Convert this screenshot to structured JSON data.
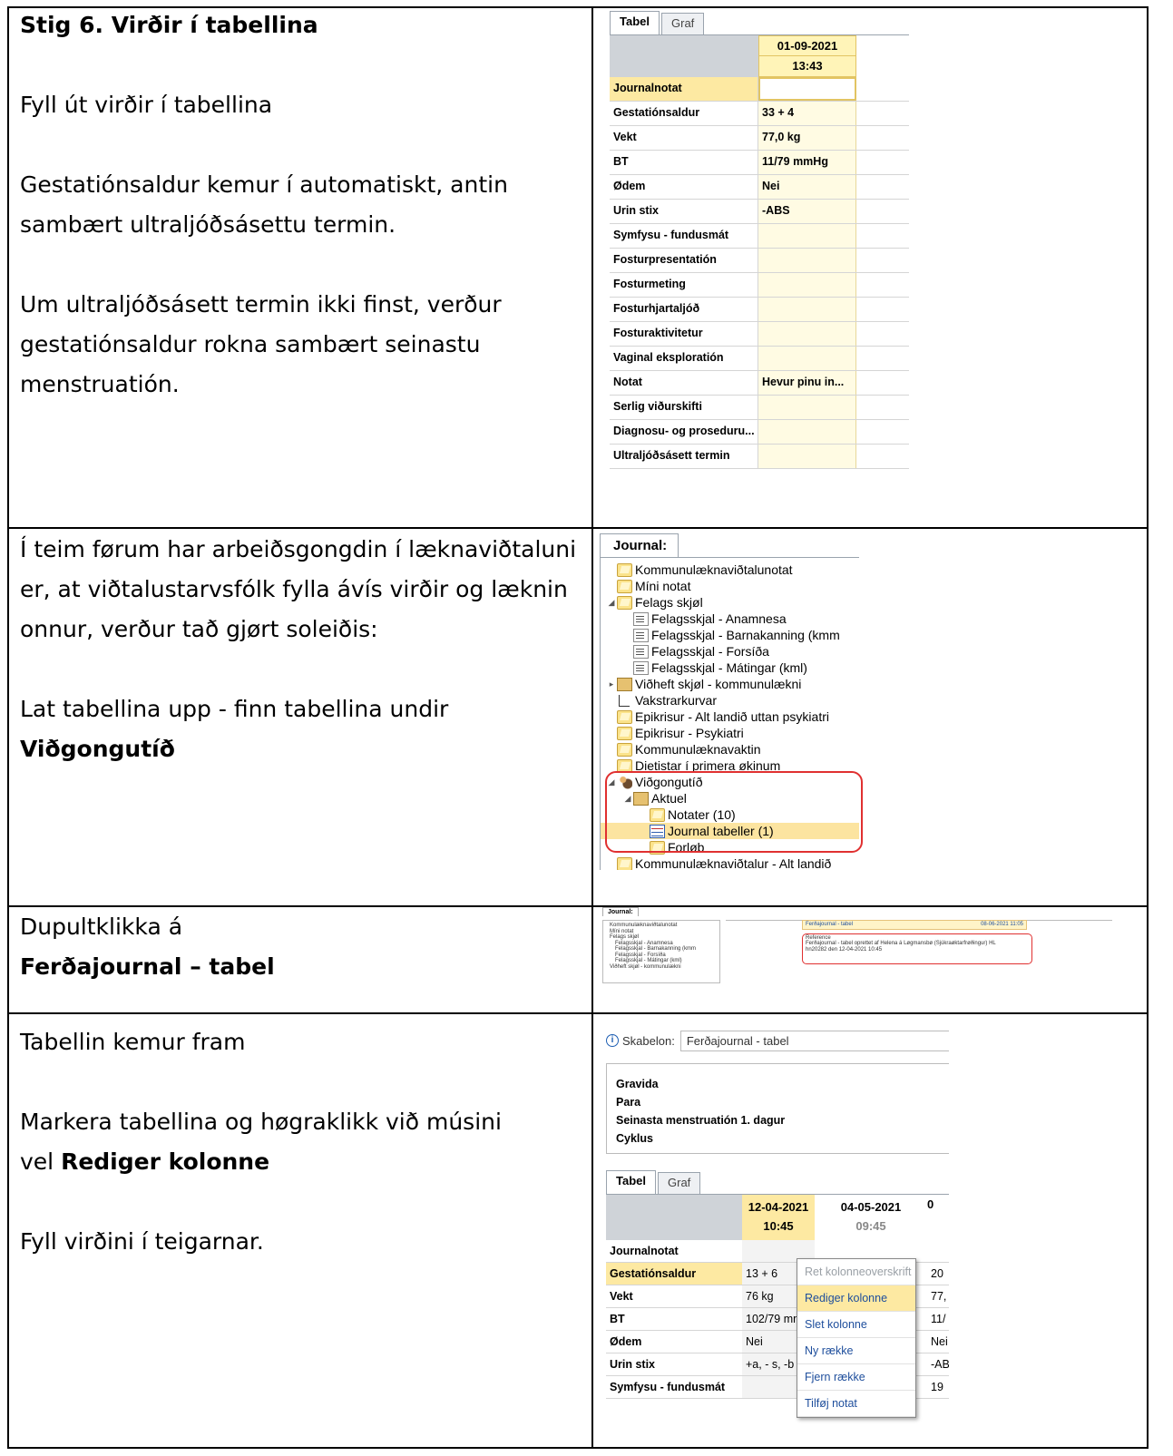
{
  "row1": {
    "title": "Stig 6. Virðir í tabellina",
    "p1": "Fyll út virðir í tabellina",
    "p2a": "Gestatiónsaldur kemur í automatiskt, antin",
    "p2b": "sambært ultraljóðsásettu termin.",
    "p3a": "Um ultraljóðsásett termin ikki finst, verður",
    "p3b": "gestatiónsaldur rokna sambært seinastu",
    "p3c": "menstruatión.",
    "ui": {
      "tabs": [
        "Tabel",
        "Graf"
      ],
      "date": "01-09-2021",
      "time": "13:43",
      "rows": [
        {
          "label": "Journalnotat",
          "value": ""
        },
        {
          "label": "Gestatiónsaldur",
          "value": "33 + 4"
        },
        {
          "label": "Vekt",
          "value": "77,0 kg"
        },
        {
          "label": "BT",
          "value": "11/79 mmHg"
        },
        {
          "label": "Ødem",
          "value": "Nei"
        },
        {
          "label": "Urin stix",
          "value": "-ABS"
        },
        {
          "label": "Symfysu - fundusmát",
          "value": ""
        },
        {
          "label": "Fosturpresentatión",
          "value": ""
        },
        {
          "label": "Fosturmeting",
          "value": ""
        },
        {
          "label": "Fosturhjartaljóð",
          "value": ""
        },
        {
          "label": "Fosturaktivitetur",
          "value": ""
        },
        {
          "label": "Vaginal eksploratión",
          "value": ""
        },
        {
          "label": "Notat",
          "value": "Hevur pinu in..."
        },
        {
          "label": "Serlig viðurskifti",
          "value": ""
        },
        {
          "label": "Diagnosu- og proseduru...",
          "value": ""
        },
        {
          "label": "Ultraljóðsásett termin",
          "value": ""
        }
      ]
    }
  },
  "row2": {
    "p1a": "Í teim førum har arbeiðsgongdin í læknaviðtaluni",
    "p1b": "er, at viðtalustarvsfólk fylla ávís virðir og læknin",
    "p1c": "onnur, verður tað gjørt soleiðis:",
    "p2": "Lat tabellina upp - finn tabellina undir",
    "p2bold": "Viðgongutíð",
    "ui": {
      "tab": "Journal:",
      "items": [
        {
          "label": "Kommunulæknaviðtalunotat",
          "indent": 1,
          "icon": "folder-icon"
        },
        {
          "label": "Míni notat",
          "indent": 1,
          "icon": "folder-icon"
        },
        {
          "label": "Felags skjøl",
          "indent": 1,
          "icon": "folder-icon",
          "arrow": "◢"
        },
        {
          "label": "Felagsskjal - Anamnesa",
          "indent": 2,
          "icon": "form-icon"
        },
        {
          "label": "Felagsskjal - Barnakanning (kmm",
          "indent": 2,
          "icon": "form-icon"
        },
        {
          "label": "Felagsskjal - Forsíða",
          "indent": 2,
          "icon": "form-icon"
        },
        {
          "label": "Felagsskjal - Mátingar (kml)",
          "indent": 2,
          "icon": "form-icon"
        },
        {
          "label": "Viðheft skjøl - kommunulækni",
          "indent": 1,
          "icon": "book-icon",
          "arrow": "▸"
        },
        {
          "label": "Vakstrarkurvar",
          "indent": 1,
          "icon": "chart-icon"
        },
        {
          "label": "Epikrisur - Alt landið uttan psykiatri",
          "indent": 1,
          "icon": "folder-icon"
        },
        {
          "label": "Epikrisur - Psykiatri",
          "indent": 1,
          "icon": "folder-icon"
        },
        {
          "label": "Kommunulæknavaktin",
          "indent": 1,
          "icon": "folder-icon"
        },
        {
          "label": "Dietistar í primera økinum",
          "indent": 1,
          "icon": "folder-icon"
        },
        {
          "label": "Viðgongutíð",
          "indent": 1,
          "icon": "people-icon",
          "arrow": "◢"
        },
        {
          "label": "Aktuel",
          "indent": 2,
          "icon": "book-icon",
          "arrow": "◢"
        },
        {
          "label": "Notater  (10)",
          "indent": 3,
          "icon": "folder-icon"
        },
        {
          "label": "Journal tabeller (1)",
          "indent": 3,
          "icon": "table-icon",
          "selected": true
        },
        {
          "label": "Forløb",
          "indent": 3,
          "icon": "folder-icon"
        },
        {
          "label": "Kommunulæknaviðtalur - Alt landið",
          "indent": 1,
          "icon": "folder-icon"
        }
      ]
    }
  },
  "row3": {
    "p1": "Dupultklikka á",
    "p2bold": "Ferðajournal – tabel",
    "ui": {
      "tab": "Journal:",
      "left_items": [
        "Kommunulæknaviðtalunotat",
        "Míni notat",
        "Felags skjøl",
        "Felagsskjal - Anamnesa",
        "Felagsskjal - Barnakanning (kmm",
        "Felagsskjal - Forsíða",
        "Felagsskjal - Mátingar (kml)",
        "Viðheft skjøl - kommunulækni"
      ],
      "card_title": "Ferðajournal - tabel",
      "card_date": "08-06-2021 11:05",
      "card_line1": "Reference",
      "card_line2": "Ferðajournal - tabel    oprettet af Helena á Løgmansbø (Sjúkraøktarfrøðingur) HL",
      "card_line3": "hn20282 den 12-04-2021 10:45"
    }
  },
  "row4": {
    "p1": "Tabellin kemur fram",
    "p2a": "Markera tabellina og høgraklikk við músini",
    "p2b_pre": "vel ",
    "p2b_bold": "Rediger kolonne",
    "p3": "Fyll virðini í teigarnar.",
    "ui": {
      "skabelon_label": "Skabelon:",
      "skabelon_value": "Ferðajournal - tabel",
      "info": [
        "Gravida",
        "Para",
        "Seinasta menstruatión 1. dagur",
        "Cyklus"
      ],
      "tabs": [
        "Tabel",
        "Graf"
      ],
      "col1_date": "12-04-2021",
      "col1_time": "10:45",
      "col2_date": "04-05-2021",
      "col2_time": "09:45",
      "col3_date": "0",
      "rows": [
        {
          "label": "Journalnotat",
          "v1": "",
          "v3": ""
        },
        {
          "label": "Gestatiónsaldur",
          "v1": "13 + 6",
          "v3": "20"
        },
        {
          "label": "Vekt",
          "v1": "76 kg",
          "v3": "77,"
        },
        {
          "label": "BT",
          "v1": "102/79 mm",
          "v3": "11/"
        },
        {
          "label": "Ødem",
          "v1": "Nei",
          "v3": "Nei"
        },
        {
          "label": "Urin stix",
          "v1": "+a, - s, -b",
          "v3": "-AB"
        },
        {
          "label": "Symfysu - fundusmát",
          "v1": "",
          "v3": "19"
        }
      ],
      "menu": [
        "Ret kolonneoverskrift",
        "Rediger kolonne",
        "Slet kolonne",
        "Ny række",
        "Fjern række",
        "Tilføj notat"
      ]
    }
  }
}
